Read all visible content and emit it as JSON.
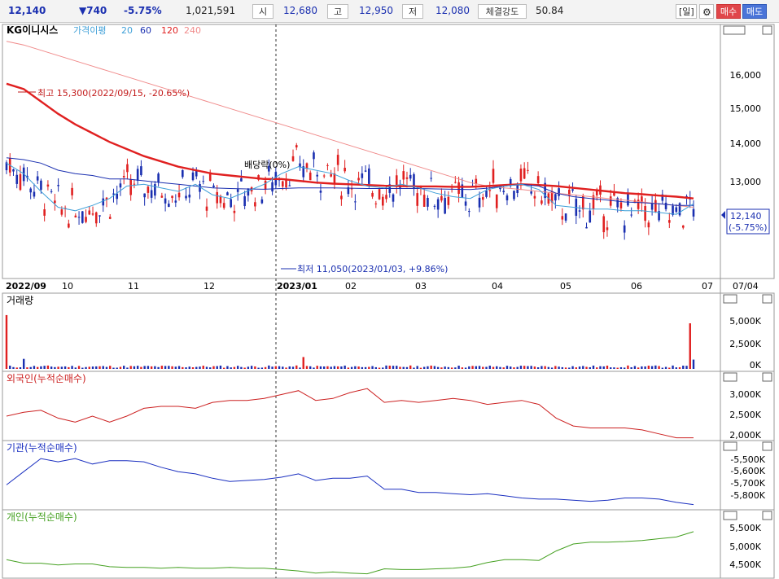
{
  "quote": {
    "price": "12,140",
    "change": "▼740",
    "change_pct": "-5.75%",
    "volume": "1,021,591",
    "open_label": "시",
    "open": "12,680",
    "high_label": "고",
    "high": "12,950",
    "low_label": "저",
    "low": "12,080",
    "strength_label": "체결강도",
    "strength": "50.84",
    "period_btn": "[일]",
    "settings_icon": "gear-icon",
    "buy_btn": "매수",
    "sell_btn": "매도"
  },
  "colors": {
    "up": "#e02020",
    "down": "#1a2fb0",
    "ma20": "#3fa0d8",
    "ma60": "#1a2fb0",
    "ma120": "#e02020",
    "ma240": "#f08a8a",
    "foreign": "#cc2020",
    "institution": "#1a2fc0",
    "individual": "#44a020"
  },
  "chart_data": [
    {
      "type": "candlestick",
      "title": "KG이니시스",
      "legend": [
        "가격이평",
        "20",
        "60",
        "120",
        "240"
      ],
      "ylim": [
        10800,
        17200
      ],
      "y_ticks": [
        "16,000",
        "15,000",
        "14,000",
        "13,000"
      ],
      "x_ticks": [
        "2022/09",
        "10",
        "11",
        "12",
        "2023/01",
        "02",
        "03",
        "04",
        "05",
        "06",
        "07",
        "07/04"
      ],
      "annotations": {
        "high": "최고 15,300(2022/09/15, -20.65%)",
        "low": "최저 11,050(2023/01/03, +9.86%)",
        "dividend": "배당락(0%)"
      },
      "current_price": "12,140",
      "current_pct": "(-5.75%)",
      "ma_lines": {
        "ma20": [
          13500,
          13200,
          12700,
          12250,
          12150,
          12300,
          12500,
          12850,
          12900,
          12800,
          12700,
          12900,
          12600,
          12500,
          12700,
          12900,
          13200,
          13400,
          13300,
          13200,
          13000,
          12850,
          12800,
          12900,
          12800,
          12650,
          12550,
          12500,
          12750,
          12850,
          12900,
          12750,
          12300,
          12250,
          12200,
          12200,
          12150,
          12150,
          12100,
          12050,
          12350
        ],
        "ma60": [
          13650,
          13600,
          13500,
          13300,
          13200,
          13150,
          13050,
          13050,
          13000,
          12950,
          12900,
          12850,
          12800,
          12780,
          12770,
          12760,
          12780,
          12800,
          12800,
          12800,
          12790,
          12780,
          12780,
          12780,
          12780,
          12770,
          12760,
          12750,
          12790,
          12850,
          12900,
          12850,
          12650,
          12550,
          12500,
          12450,
          12400,
          12380,
          12350,
          12300,
          12300
        ],
        "ma120": [
          15750,
          15600,
          15250,
          14900,
          14600,
          14350,
          14100,
          13900,
          13700,
          13550,
          13400,
          13300,
          13200,
          13150,
          13100,
          13050,
          13050,
          13000,
          12950,
          12920,
          12900,
          12880,
          12860,
          12850,
          12840,
          12840,
          12830,
          12830,
          12850,
          12880,
          12900,
          12880,
          12850,
          12800,
          12750,
          12700,
          12650,
          12620,
          12580,
          12550,
          12500
        ],
        "ma240": [
          16950,
          16850,
          16700,
          16550,
          16400,
          16250,
          16100,
          15950,
          15800,
          15650,
          15500,
          15350,
          15200,
          15050,
          14900,
          14750,
          14600,
          14450,
          14300,
          14150,
          14000,
          13850,
          13700,
          13550,
          13400,
          13250,
          13100,
          12950,
          12850,
          12800,
          12750,
          12700,
          12650,
          12600,
          12550,
          12500,
          12450,
          12400,
          12350,
          12300,
          12250
        ]
      }
    },
    {
      "type": "bar",
      "title": "거래량",
      "y_ticks": [
        "5,000K",
        "2,500K",
        "0K"
      ],
      "spikes": {
        "start": 5900,
        "mid_feb": 1300,
        "end": 5000,
        "last": 1021
      }
    },
    {
      "type": "line",
      "title": "외국인(누적순매수)",
      "y_ticks": [
        "3,000K",
        "2,500K",
        "2,000K"
      ],
      "ylim": [
        1950,
        3400
      ],
      "values": [
        2550,
        2650,
        2700,
        2500,
        2400,
        2550,
        2400,
        2550,
        2750,
        2800,
        2800,
        2750,
        2900,
        2950,
        2950,
        3000,
        3100,
        3200,
        2950,
        3000,
        3150,
        3250,
        2900,
        2950,
        2900,
        2950,
        3000,
        2950,
        2850,
        2900,
        2950,
        2850,
        2500,
        2300,
        2250,
        2250,
        2250,
        2200,
        2100,
        2000,
        2000
      ]
    },
    {
      "type": "line",
      "title": "기관(누적순매수)",
      "y_ticks": [
        "-5,500K",
        "-5,600K",
        "-5,700K",
        "-5,800K"
      ],
      "ylim": [
        -5900,
        -5380
      ],
      "values": [
        -5680,
        -5560,
        -5440,
        -5470,
        -5440,
        -5490,
        -5460,
        -5460,
        -5470,
        -5520,
        -5560,
        -5580,
        -5620,
        -5650,
        -5640,
        -5630,
        -5610,
        -5580,
        -5640,
        -5620,
        -5620,
        -5600,
        -5720,
        -5720,
        -5750,
        -5750,
        -5760,
        -5770,
        -5760,
        -5780,
        -5800,
        -5810,
        -5810,
        -5820,
        -5830,
        -5820,
        -5800,
        -5800,
        -5810,
        -5840,
        -5860
      ]
    },
    {
      "type": "line",
      "title": "개인(누적순매수)",
      "y_ticks": [
        "5,500K",
        "5,000K",
        "4,500K"
      ],
      "ylim": [
        4320,
        5900
      ],
      "values": [
        4800,
        4700,
        4700,
        4650,
        4680,
        4680,
        4600,
        4580,
        4580,
        4560,
        4580,
        4560,
        4560,
        4580,
        4560,
        4560,
        4520,
        4480,
        4420,
        4450,
        4420,
        4400,
        4540,
        4520,
        4520,
        4540,
        4560,
        4600,
        4720,
        4800,
        4800,
        4780,
        5050,
        5250,
        5300,
        5300,
        5320,
        5350,
        5400,
        5450,
        5600
      ]
    }
  ]
}
